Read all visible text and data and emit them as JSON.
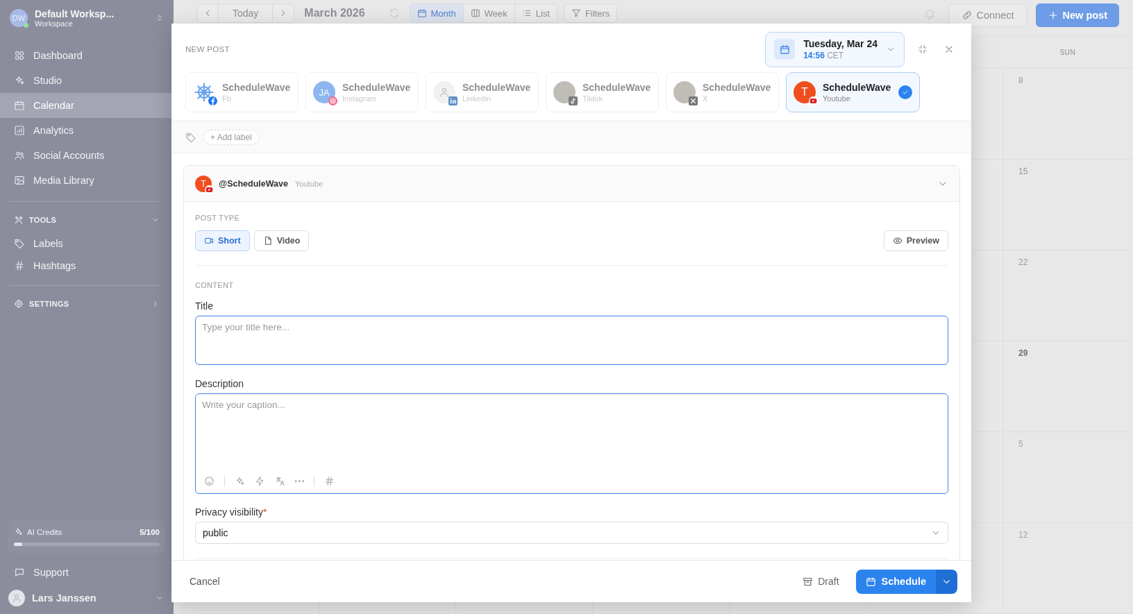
{
  "sidebar": {
    "workspace": {
      "initials": "DW",
      "name": "Default Worksp...",
      "subtitle": "Workspace",
      "online": true
    },
    "nav": [
      {
        "label": "Dashboard",
        "selected": false
      },
      {
        "label": "Studio",
        "selected": false
      },
      {
        "label": "Calendar",
        "selected": true
      },
      {
        "label": "Analytics",
        "selected": false
      },
      {
        "label": "Social Accounts",
        "selected": false
      },
      {
        "label": "Media Library",
        "selected": false
      }
    ],
    "sections": [
      {
        "title": "TOOLS",
        "expanded": true,
        "items": [
          {
            "label": "Labels"
          },
          {
            "label": "Hashtags"
          }
        ]
      },
      {
        "title": "SETTINGS",
        "expanded": false
      }
    ],
    "ai_credits": {
      "label": "AI Credits",
      "count": "5/100",
      "level": 0.05
    },
    "support": "Support",
    "user": {
      "name": "Lars Janssen"
    }
  },
  "toolbar": {
    "today": "Today",
    "month_title": "March 2026",
    "views": [
      {
        "label": "Month",
        "selected": true
      },
      {
        "label": "Week",
        "selected": false
      },
      {
        "label": "List",
        "selected": false
      }
    ],
    "filters": "Filters",
    "connect": "Connect",
    "new_post": "New post"
  },
  "calendar": {
    "weekday_headers": [
      "SUN"
    ],
    "sunday_dates": [
      {
        "day": "8",
        "kind": "past"
      },
      {
        "day": "15",
        "kind": "past"
      },
      {
        "day": "22",
        "kind": "past"
      },
      {
        "day": "29",
        "kind": "upcoming"
      },
      {
        "day": "5",
        "kind": "next_month"
      },
      {
        "day": "12",
        "kind": "next_month"
      }
    ]
  },
  "modal": {
    "title": "NEW POST",
    "date": {
      "day": "Tuesday, Mar 24",
      "time": "14:56",
      "zone": "CET"
    },
    "accounts": [
      {
        "name": "ScheduleWave",
        "platform": "Fb",
        "avatar": {
          "kind": "logo"
        },
        "selected": false
      },
      {
        "name": "ScheduleWave",
        "platform": "Instagram",
        "avatar": {
          "kind": "initials",
          "text": "JA"
        },
        "selected": false
      },
      {
        "name": "ScheduleWave",
        "platform": "Linkedin",
        "avatar": {
          "kind": "silhouette"
        },
        "selected": false
      },
      {
        "name": "ScheduleWave",
        "platform": "Tiktok",
        "avatar": {
          "kind": "photo"
        },
        "selected": false
      },
      {
        "name": "ScheduleWave",
        "platform": "X",
        "avatar": {
          "kind": "photo"
        },
        "selected": false
      },
      {
        "name": "ScheduleWave",
        "platform": "Youtube",
        "avatar": {
          "kind": "letter",
          "text": "T"
        },
        "selected": true
      }
    ],
    "add_label": "+ Add label",
    "post": {
      "handle": "@ScheduleWave",
      "platform": "Youtube",
      "avatar": {
        "kind": "letter",
        "text": "T"
      },
      "expanded": true,
      "post_type_label": "POST TYPE",
      "types": [
        {
          "label": "Short",
          "selected": true
        },
        {
          "label": "Video",
          "selected": false
        }
      ],
      "preview": "Preview",
      "content_label": "CONTENT",
      "title_field": {
        "label": "Title",
        "placeholder": "Type your title here..."
      },
      "description_field": {
        "label": "Description",
        "placeholder": "Write your caption..."
      },
      "privacy": {
        "label": "Privacy visibility",
        "required_mark": "*",
        "value": "public"
      }
    },
    "footer": {
      "cancel": "Cancel",
      "draft": "Draft",
      "schedule": "Schedule"
    }
  }
}
